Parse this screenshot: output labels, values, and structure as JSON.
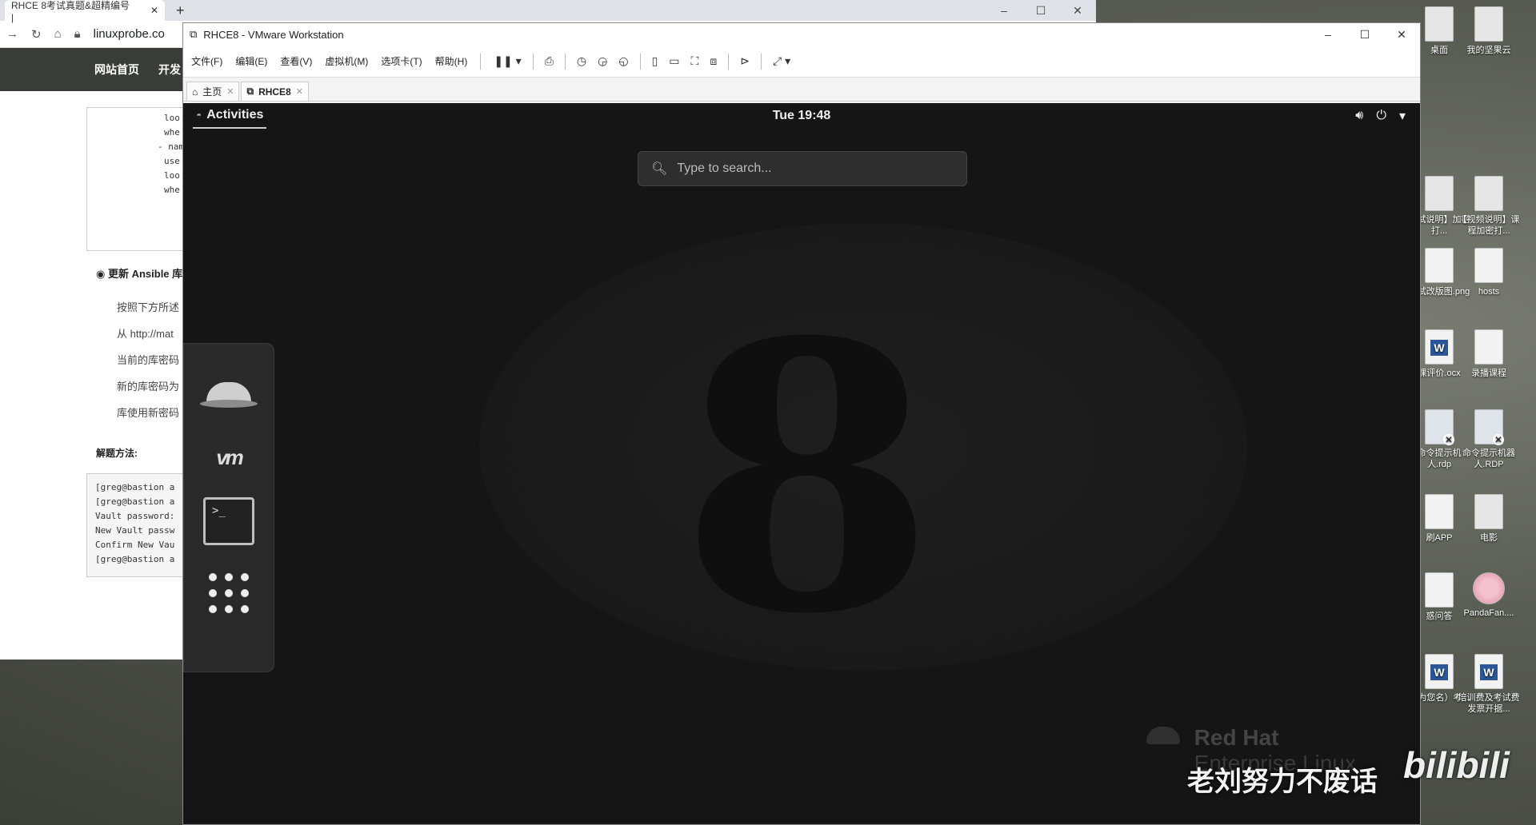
{
  "browser": {
    "tab_title": "RHCE 8考试真题&超精编号 | ",
    "tab_close": "✕",
    "new_tab": "+",
    "url": "linuxprobe.co",
    "nav": [
      "网站首页",
      "开发"
    ],
    "code_lines": [
      "loo",
      "whe",
      "- nam",
      "use",
      "",
      "",
      "loo",
      "whe"
    ],
    "section_title": "更新 Ansible 库",
    "steps": [
      "按照下方所述",
      "从 http://mat",
      "当前的库密码",
      "新的库密码为",
      "库使用新密码"
    ],
    "method_label": "解题方法:",
    "terminal_lines": [
      "[greg@bastion a",
      "[greg@bastion a",
      "Vault password:",
      "New Vault passw",
      "Confirm New Vau",
      "[greg@bastion a"
    ]
  },
  "vmware": {
    "title": "RHCE8 - VMware Workstation",
    "menus": [
      "文件(F)",
      "编辑(E)",
      "查看(V)",
      "虚拟机(M)",
      "选项卡(T)",
      "帮助(H)"
    ],
    "tabs": [
      {
        "label": "主页",
        "close": "✕"
      },
      {
        "label": "RHCE8",
        "close": "✕"
      }
    ]
  },
  "guest": {
    "activities": "Activities",
    "clock": "Tue 19:48",
    "search_placeholder": "Type to search...",
    "brand_line1": "Red Hat",
    "brand_line2": "Enterprise Linux"
  },
  "desktop_icons": [
    {
      "label": "桌面",
      "type": "folder"
    },
    {
      "label": "我的坚果云",
      "type": "folder"
    },
    {
      "label": "考试说明】加密打...",
      "type": "folder"
    },
    {
      "label": "【视频说明】课程加密打...",
      "type": "folder"
    },
    {
      "label": "考试改版图.png",
      "type": "file"
    },
    {
      "label": "hosts",
      "type": "file"
    },
    {
      "label": "课评价.ocx",
      "type": "word"
    },
    {
      "label": "录播课程",
      "type": "file"
    },
    {
      "label": "命令提示机人.rdp",
      "type": "rdp"
    },
    {
      "label": "命令提示机器人.RDP",
      "type": "rdp"
    },
    {
      "label": "刷APP",
      "type": "file"
    },
    {
      "label": "电影",
      "type": "folder"
    },
    {
      "label": "惑问答",
      "type": "file"
    },
    {
      "label": "PandaFan....",
      "type": "panda"
    },
    {
      "label": "改为您名）考...",
      "type": "word"
    },
    {
      "label": "培训费及考试费发票开据...",
      "type": "word"
    }
  ],
  "watermark": "老刘努力不废话",
  "bili": "bilibili",
  "colors": {
    "guest_bg": "#151515",
    "panel": "#2a2a2a",
    "accent": "#2b579a"
  }
}
